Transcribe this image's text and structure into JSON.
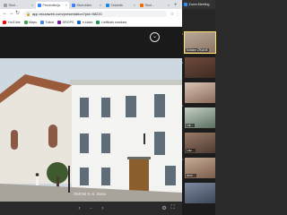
{
  "browser": {
    "tabs": [
      {
        "label": "Stud…",
        "color": "#e8eaed",
        "active": false
      },
      {
        "label": "Prezentācija",
        "color": "#3b82f6",
        "active": true
      },
      {
        "label": "Stud vides",
        "color": "#3b82f6",
        "active": false
      },
      {
        "label": "Ceļvedis",
        "color": "#1e88e5",
        "active": false
      },
      {
        "label": "Stud…",
        "color": "#ef6c00",
        "active": false
      }
    ],
    "new_tab": "+",
    "url": "app.mozaweb.com/presentation?pid=98220",
    "bookmarks": [
      {
        "label": "YouTube",
        "color": "#ff0000"
      },
      {
        "label": "Maps",
        "color": "#34a853"
      },
      {
        "label": "Tulkot",
        "color": "#4285f4"
      },
      {
        "label": "DROPS",
        "color": "#7b1fa2"
      },
      {
        "label": "e-klase",
        "color": "#1565c0"
      },
      {
        "label": "Lielākais saraksts",
        "color": "#0f9d58"
      }
    ]
  },
  "presentation": {
    "caption": "OMOM 5.-6. klase",
    "page_indicator": "⋯"
  },
  "zoom": {
    "title": "Zoom Meeting",
    "participants": [
      {
        "name": "Kristine ZĪKANE",
        "speaking": true
      },
      {
        "name": "",
        "speaking": false
      },
      {
        "name": "",
        "speaking": false
      },
      {
        "name": "Lai…",
        "speaking": false
      },
      {
        "name": "Lau…",
        "speaking": false
      },
      {
        "name": "Anni…",
        "speaking": false
      },
      {
        "name": "",
        "speaking": false
      }
    ]
  }
}
